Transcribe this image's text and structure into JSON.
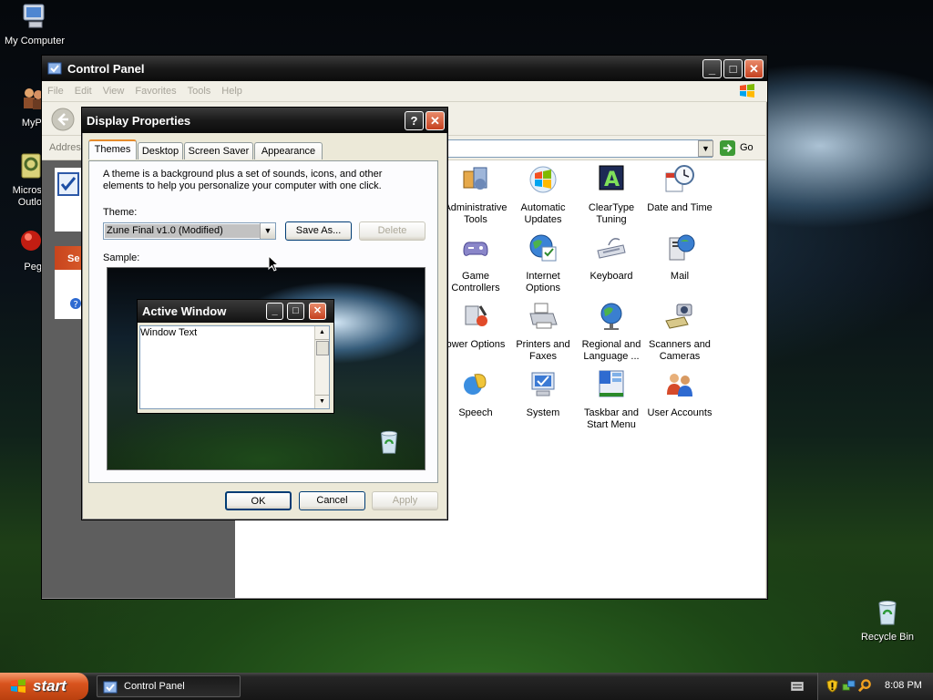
{
  "desktop": {
    "icons": [
      {
        "label": "My Computer"
      },
      {
        "label": "MyPa"
      },
      {
        "label": "Micros Outlo"
      },
      {
        "label": "Peg"
      },
      {
        "label": "Recycle Bin"
      }
    ]
  },
  "control_panel": {
    "title": "Control Panel",
    "menu": [
      "File",
      "Edit",
      "View",
      "Favorites",
      "Tools",
      "Help"
    ],
    "address_label": "Addres",
    "go_label": "Go",
    "left_pane_label": "Se",
    "items": [
      {
        "label": "Administrative Tools",
        "icon": "admin-tools-icon"
      },
      {
        "label": "Automatic Updates",
        "icon": "automatic-updates-icon"
      },
      {
        "label": "ClearType Tuning",
        "icon": "cleartype-icon"
      },
      {
        "label": "Date and Time",
        "icon": "clock-icon"
      },
      {
        "label": "Game Controllers",
        "icon": "gamepad-icon"
      },
      {
        "label": "Internet Options",
        "icon": "globe-icon"
      },
      {
        "label": "Keyboard",
        "icon": "keyboard-icon"
      },
      {
        "label": "Mail",
        "icon": "mail-icon"
      },
      {
        "label": "ower Options",
        "icon": "power-icon"
      },
      {
        "label": "Printers and Faxes",
        "icon": "printer-icon"
      },
      {
        "label": "Regional and Language ...",
        "icon": "regional-globe-icon"
      },
      {
        "label": "Scanners and Cameras",
        "icon": "scanner-icon"
      },
      {
        "label": "Speech",
        "icon": "speech-icon"
      },
      {
        "label": "System",
        "icon": "system-icon"
      },
      {
        "label": "Taskbar and Start Menu",
        "icon": "taskbar-icon"
      },
      {
        "label": "User Accounts",
        "icon": "users-icon"
      }
    ]
  },
  "display_properties": {
    "title": "Display Properties",
    "help_label": "?",
    "tabs": [
      "Themes",
      "Desktop",
      "Screen Saver",
      "Appearance"
    ],
    "description": "A theme is a background plus a set of sounds, icons, and other elements to help you personalize your computer with one click.",
    "theme_label": "Theme:",
    "theme_value": "Zune Final v1.0 (Modified)",
    "save_as": "Save As...",
    "delete": "Delete",
    "sample_label": "Sample:",
    "sample_window_title": "Active Window",
    "sample_window_text": "Window Text",
    "ok": "OK",
    "cancel": "Cancel",
    "apply": "Apply"
  },
  "taskbar": {
    "start": "start",
    "task": "Control Panel",
    "clock": "8:08 PM"
  }
}
